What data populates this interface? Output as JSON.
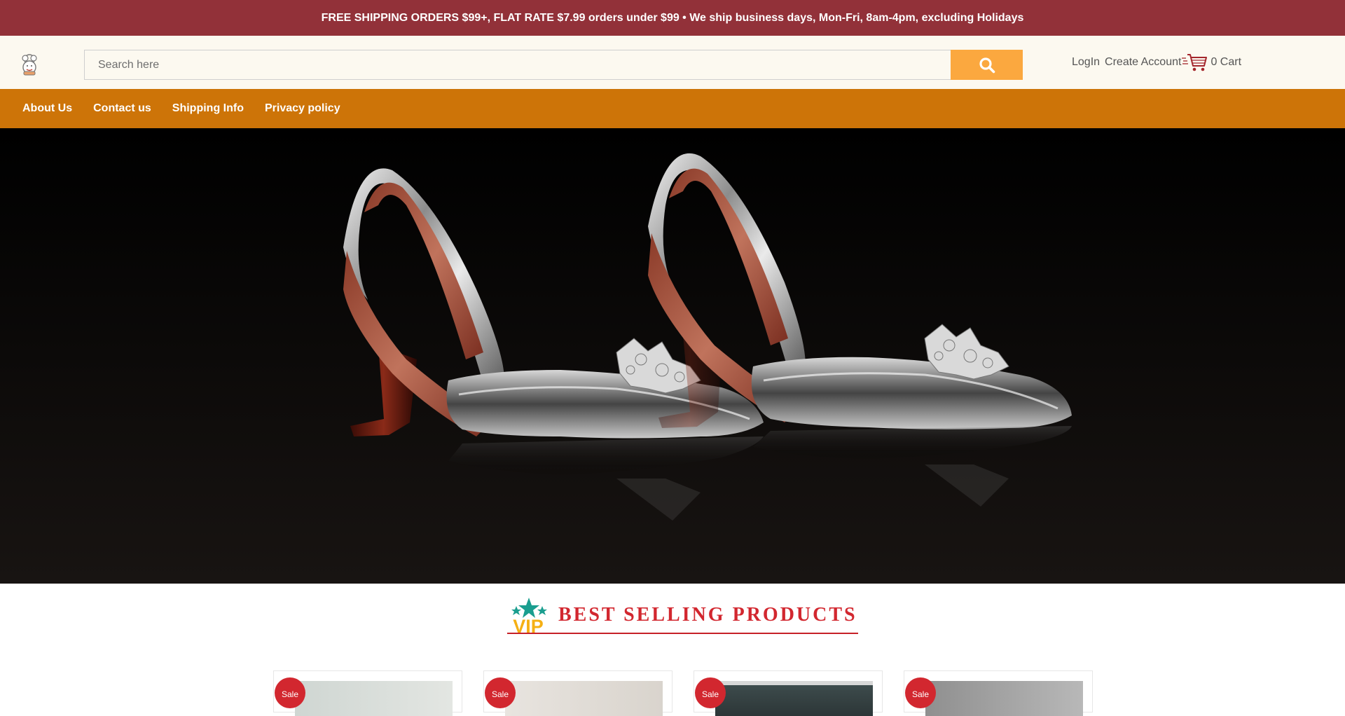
{
  "announcement": "FREE SHIPPING ORDERS $99+, FLAT RATE $7.99 orders under $99 • We ship business days, Mon-Fri, 8am-4pm, excluding Holidays",
  "header": {
    "logo_icon": "chef-logo-icon",
    "search_placeholder": "Search here",
    "search_value": "",
    "search_icon": "search-icon",
    "login_label": "LogIn",
    "create_account_label": "Create Account",
    "cart_icon": "shopping-cart-icon",
    "cart_label": "0 Cart"
  },
  "nav": {
    "items": [
      {
        "label": "About Us"
      },
      {
        "label": "Contact us"
      },
      {
        "label": "Shipping Info"
      },
      {
        "label": "Privacy policy"
      }
    ]
  },
  "hero": {
    "image": "silver-slingback-heels-banner"
  },
  "best_selling": {
    "icon": "vip-star-icon",
    "title": "BEST SELLING PRODUCTS"
  },
  "products": [
    {
      "badge": "Sale"
    },
    {
      "badge": "Sale"
    },
    {
      "badge": "Sale"
    },
    {
      "badge": "Sale"
    }
  ],
  "colors": {
    "announcement_bg": "#923139",
    "header_bg": "#fcf9f0",
    "search_button": "#fba83f",
    "nav_bg": "#cd7408",
    "accent_red": "#d2272f"
  }
}
